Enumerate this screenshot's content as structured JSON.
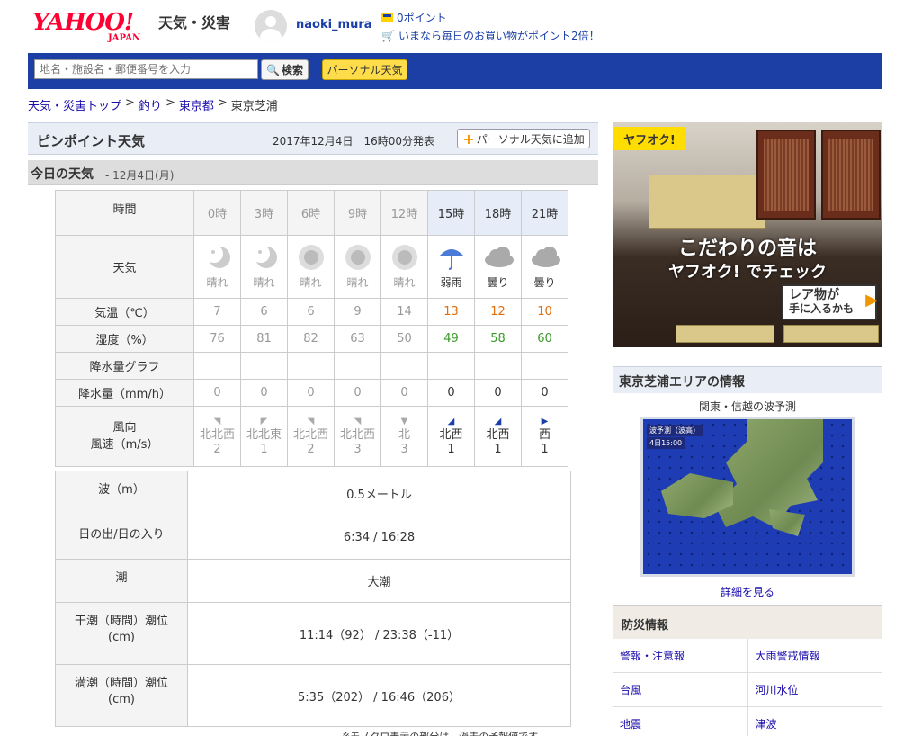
{
  "header": {
    "logo_main": "YAHOO!",
    "logo_sub": "JAPAN",
    "service_title": "天気・災害",
    "username": "naoki_mura",
    "points_text": "0ポイント",
    "promo_text": "いまなら毎日のお買い物がポイント2倍！"
  },
  "search": {
    "placeholder": "地名・施設名・郵便番号を入力",
    "button_label": "検索",
    "personal_label": "パーソナル天気"
  },
  "breadcrumb": {
    "items": [
      "天気・災害トップ",
      "釣り",
      "東京都"
    ],
    "current": "東京芝浦",
    "separator": ">"
  },
  "pinpoint": {
    "title": "ピンポイント天気",
    "date": "2017年12月4日　16時00分発表",
    "add_label": "パーソナル天気に追加"
  },
  "today": {
    "title": "今日の天気",
    "date": "- 12月4日(月)"
  },
  "forecast": {
    "row_labels": {
      "time": "時間",
      "weather": "天気",
      "temp": "気温（℃）",
      "humidity": "湿度（%）",
      "precip_graph": "降水量グラフ",
      "precip": "降水量（mm/h）",
      "wind_dir": "風向",
      "wind_speed": "風速（m/s）"
    },
    "hours": [
      "0時",
      "3時",
      "6時",
      "9時",
      "12時",
      "15時",
      "18時",
      "21時"
    ],
    "weather": [
      "晴れ",
      "晴れ",
      "晴れ",
      "晴れ",
      "晴れ",
      "弱雨",
      "曇り",
      "曇り"
    ],
    "weather_icons": [
      "moon-icon",
      "moon-icon",
      "sun-icon",
      "sun-icon",
      "sun-icon",
      "umbrella-icon",
      "cloud-icon",
      "cloud-icon"
    ],
    "temps": [
      "7",
      "6",
      "6",
      "9",
      "14",
      "13",
      "12",
      "10"
    ],
    "humidity": [
      "76",
      "81",
      "82",
      "63",
      "50",
      "49",
      "58",
      "60"
    ],
    "precip": [
      "0",
      "0",
      "0",
      "0",
      "0",
      "0",
      "0",
      "0"
    ],
    "wind_dir": [
      "北北西",
      "北北東",
      "北北西",
      "北北西",
      "北",
      "北西",
      "北西",
      "西"
    ],
    "wind_speed": [
      "2",
      "1",
      "2",
      "3",
      "3",
      "1",
      "1",
      "1"
    ],
    "future_start_index": 5
  },
  "details": {
    "wave_label": "波（m）",
    "wave_value": "0.5メートル",
    "sun_label": "日の出/日の入り",
    "sun_value": "6:34 / 16:28",
    "tide_label": "潮",
    "tide_value": "大潮",
    "low_label_1": "干潮（時間）潮位",
    "low_label_2": "(cm)",
    "low_value": "11:14（92） / 23:38（-11）",
    "high_label_1": "満潮（時間）潮位",
    "high_label_2": "(cm)",
    "high_value": "5:35（202） / 16:46（206）"
  },
  "footnote": "※モノクロ表示の部分は、過去の予報値です",
  "ad": {
    "logo": "ヤフオク!",
    "line1": "こだわりの音は",
    "line2": "ヤフオク! でチェック",
    "rare1": "レア物が",
    "rare2": "手に入るかも"
  },
  "area": {
    "title": "東京芝浦エリアの情報",
    "wave_caption": "関東・信越の波予測",
    "map_label": "波予測（波高）",
    "map_time": "4日15:00",
    "more_link": "詳細を見る"
  },
  "bosai": {
    "title": "防災情報",
    "links": [
      [
        "警報・注意報",
        "大雨警戒情報"
      ],
      [
        "台風",
        "河川水位"
      ],
      [
        "地震",
        "津波"
      ]
    ]
  },
  "colors": {
    "brand_red": "#ff0033",
    "nav_blue": "#1c3fa6",
    "temp_future": "#e26d0a",
    "humidity_future": "#3a9a2a"
  }
}
